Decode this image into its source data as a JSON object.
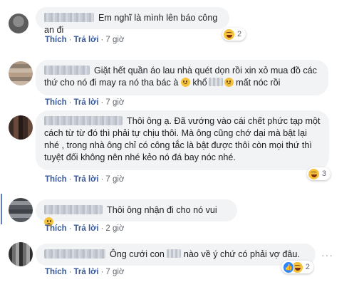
{
  "comments": [
    {
      "text": "Em nghĩ là mình lên báo công an đi",
      "action_like": "Thích",
      "action_reply": "Trả lời",
      "time": "7 giờ",
      "reaction_count": "2",
      "reaction_icons": [
        "haha-icon"
      ]
    },
    {
      "text_parts": [
        "Giặt hết quần áo lau nhà quét dọn rồi xin xỏ mua đồ các thứ cho nó đi may ra nó tha bác à",
        "khổ",
        "mất nóc rồi"
      ],
      "action_like": "Thích",
      "action_reply": "Trả lời",
      "time": "7 giờ"
    },
    {
      "text": "Thôi ông ạ. Đã vướng vào cái chết phức tạp một cách từ từ đó thì phải tự chịu thôi. Mà ông cũng chớ dại mà bật lại nhé , trong nhà ông chỉ có công tắc là bật được thôi còn mọi thứ thì tuyệt đối không nên nhé kẻo nó đá bay nóc nhé.",
      "action_like": "Thích",
      "action_reply": "Trả lời",
      "time": "7 giờ",
      "reaction_count": "3",
      "reaction_icons": [
        "haha-icon"
      ]
    },
    {
      "text": "Thôi ông nhận đi cho nó vui",
      "action_like": "Thích",
      "action_reply": "Trả lời",
      "time": "2 giờ"
    },
    {
      "text_parts": [
        "Ông cưới con",
        "nào về ý chứ có phải vợ đâu."
      ],
      "action_like": "Thích",
      "action_reply": "Trả lời",
      "time": "7 giờ",
      "reaction_count": "2",
      "reaction_icons": [
        "like-icon",
        "haha-icon"
      ]
    }
  ],
  "colors": {
    "bubble": "#f2f3f5",
    "action_link": "#385898",
    "meta_text": "#616770",
    "thread_line": "#5b7bd5"
  }
}
